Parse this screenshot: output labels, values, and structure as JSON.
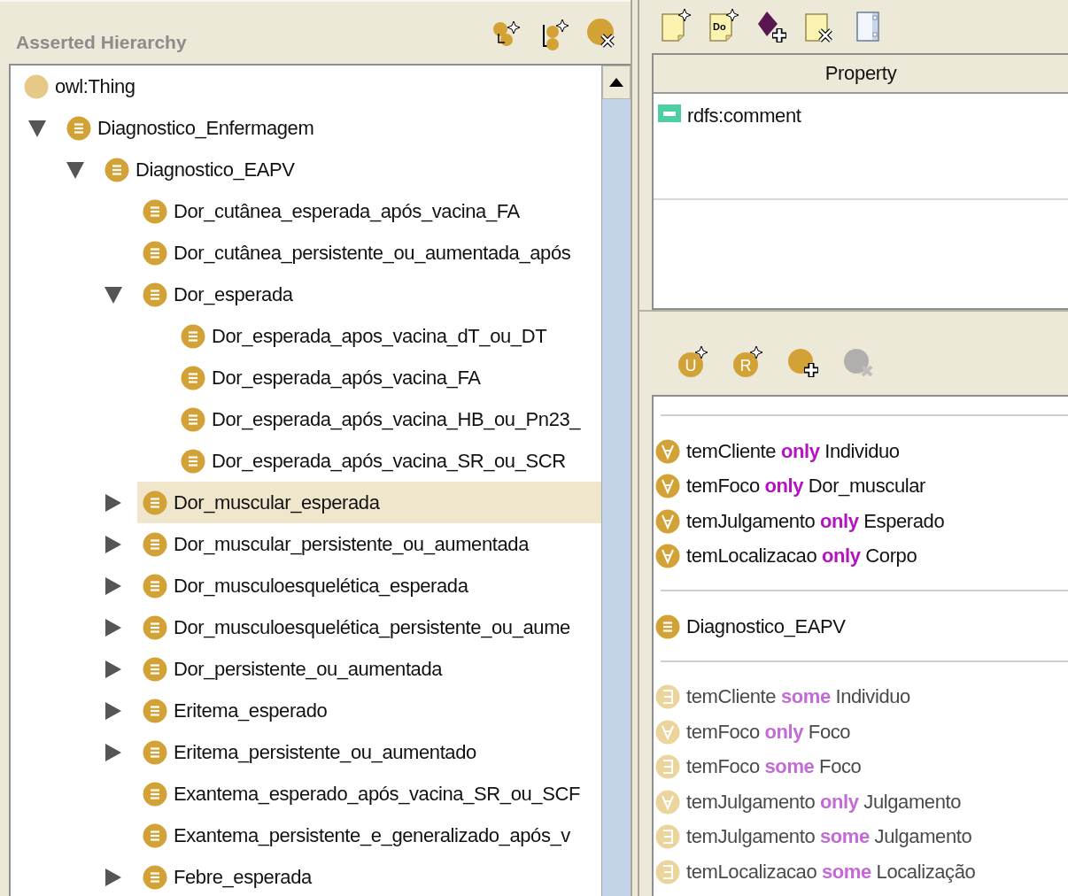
{
  "hierarchy": {
    "title": "Asserted Hierarchy",
    "toolbar": [
      {
        "kind": "add-subclass",
        "disabled": false
      },
      {
        "kind": "add-sibling",
        "disabled": false
      },
      {
        "kind": "delete",
        "disabled": false
      }
    ],
    "tree": [
      {
        "label": "owl:Thing",
        "kind": "thing",
        "selected": false,
        "children": [
          {
            "label": "Diagnostico_Enfermagem",
            "kind": "class",
            "expanded": true,
            "selected": false,
            "children": [
              {
                "label": "Diagnostico_EAPV",
                "kind": "class",
                "expanded": true,
                "selected": false,
                "children": [
                  {
                    "label": "Dor_cutânea_esperada_após_vacina_FA",
                    "kind": "class",
                    "selected": false
                  },
                  {
                    "label": "Dor_cutânea_persistente_ou_aumentada_após",
                    "kind": "class",
                    "selected": false
                  },
                  {
                    "label": "Dor_esperada",
                    "kind": "class",
                    "expanded": true,
                    "selected": false,
                    "children": [
                      {
                        "label": "Dor_esperada_apos_vacina_dT_ou_DT",
                        "kind": "class",
                        "selected": false
                      },
                      {
                        "label": "Dor_esperada_após_vacina_FA",
                        "kind": "class",
                        "selected": false
                      },
                      {
                        "label": "Dor_esperada_após_vacina_HB_ou_Pn23_",
                        "kind": "class",
                        "selected": false
                      },
                      {
                        "label": "Dor_esperada_após_vacina_SR_ou_SCR",
                        "kind": "class",
                        "selected": false
                      }
                    ]
                  },
                  {
                    "label": "Dor_muscular_esperada",
                    "kind": "class",
                    "expanded": false,
                    "selected": true
                  },
                  {
                    "label": "Dor_muscular_persistente_ou_aumentada",
                    "kind": "class",
                    "expanded": false,
                    "selected": false
                  },
                  {
                    "label": "Dor_musculoesquelética_esperada",
                    "kind": "class",
                    "expanded": false,
                    "selected": false
                  },
                  {
                    "label": "Dor_musculoesquelética_persistente_ou_aume",
                    "kind": "class",
                    "expanded": false,
                    "selected": false
                  },
                  {
                    "label": "Dor_persistente_ou_aumentada",
                    "kind": "class",
                    "expanded": false,
                    "selected": false
                  },
                  {
                    "label": "Eritema_esperado",
                    "kind": "class",
                    "expanded": false,
                    "selected": false
                  },
                  {
                    "label": "Eritema_persistente_ou_aumentado",
                    "kind": "class",
                    "expanded": false,
                    "selected": false
                  },
                  {
                    "label": "Exantema_esperado_após_vacina_SR_ou_SCF",
                    "kind": "class",
                    "selected": false
                  },
                  {
                    "label": "Exantema_persistente_e_generalizado_após_v",
                    "kind": "class",
                    "selected": false
                  },
                  {
                    "label": "Febre_esperada",
                    "kind": "class",
                    "expanded": false,
                    "selected": false
                  }
                ]
              }
            ]
          }
        ]
      }
    ]
  },
  "annotations": {
    "toolbar": [
      {
        "kind": "new-note",
        "disabled": false
      },
      {
        "kind": "new-doc",
        "glyph": "Do",
        "disabled": false
      },
      {
        "kind": "add-entity",
        "disabled": false
      },
      {
        "kind": "delete-note",
        "disabled": false
      },
      {
        "kind": "panel",
        "disabled": false
      }
    ],
    "column": "Property",
    "rows": [
      {
        "kind": "annotation",
        "label": "rdfs:comment"
      }
    ]
  },
  "conditions": {
    "toolbar": [
      {
        "kind": "circle-star",
        "glyph": "U",
        "disabled": false
      },
      {
        "kind": "circle-star",
        "glyph": "R",
        "disabled": false
      },
      {
        "kind": "circle-plus",
        "disabled": false
      },
      {
        "kind": "circle-delete",
        "disabled": true
      }
    ],
    "sections": [
      {
        "items": [
          {
            "kind": "only",
            "property": "temCliente",
            "keyword": "only",
            "filler": "Individuo",
            "inherited": false
          },
          {
            "kind": "only",
            "property": "temFoco",
            "keyword": "only",
            "filler": "Dor_muscular",
            "inherited": false
          },
          {
            "kind": "only",
            "property": "temJulgamento",
            "keyword": "only",
            "filler": "Esperado",
            "inherited": false
          },
          {
            "kind": "only",
            "property": "temLocalizacao",
            "keyword": "only",
            "filler": "Corpo",
            "inherited": false
          }
        ]
      },
      {
        "items": [
          {
            "kind": "class",
            "label": "Diagnostico_EAPV",
            "inherited": false
          }
        ]
      },
      {
        "items": [
          {
            "kind": "some",
            "property": "temCliente",
            "keyword": "some",
            "filler": "Individuo",
            "inherited": true
          },
          {
            "kind": "only",
            "property": "temFoco",
            "keyword": "only",
            "filler": "Foco",
            "inherited": true
          },
          {
            "kind": "some",
            "property": "temFoco",
            "keyword": "some",
            "filler": "Foco",
            "inherited": true
          },
          {
            "kind": "only",
            "property": "temJulgamento",
            "keyword": "only",
            "filler": "Julgamento",
            "inherited": true
          },
          {
            "kind": "some",
            "property": "temJulgamento",
            "keyword": "some",
            "filler": "Julgamento",
            "inherited": true
          },
          {
            "kind": "some",
            "property": "temLocalizacao",
            "keyword": "some",
            "filler": "Localização",
            "inherited": true
          }
        ]
      }
    ]
  }
}
